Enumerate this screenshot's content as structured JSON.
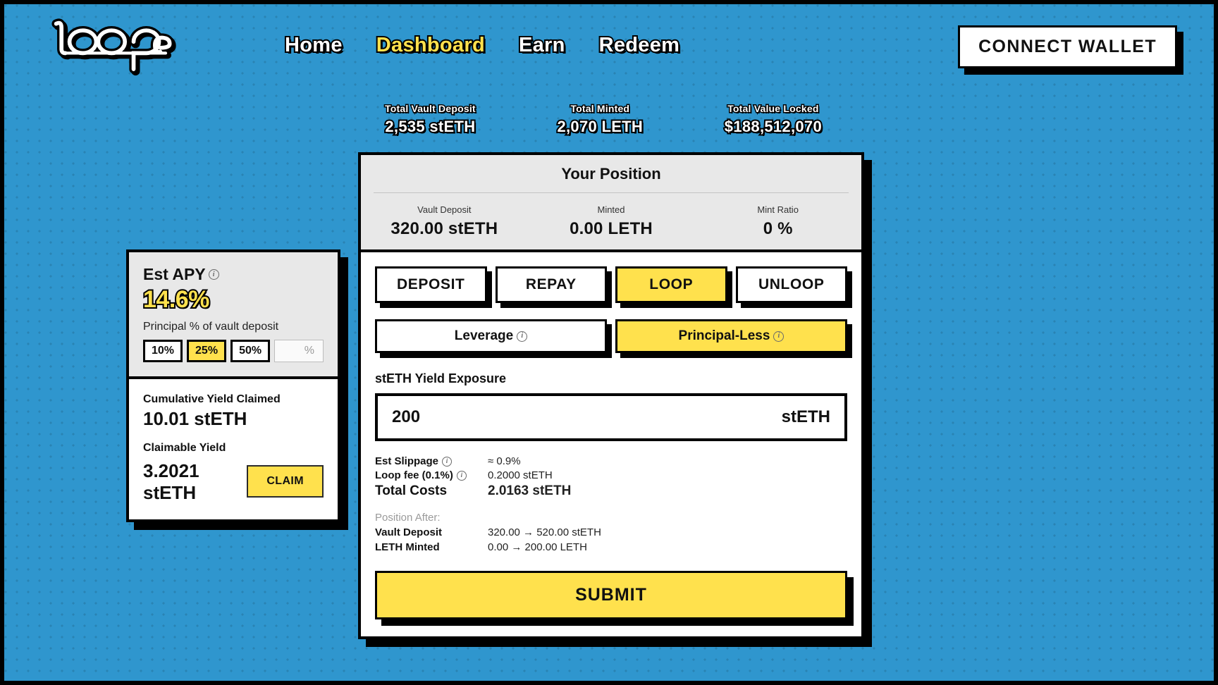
{
  "header": {
    "logo_text": "looper",
    "nav": [
      {
        "label": "Home",
        "active": false
      },
      {
        "label": "Dashboard",
        "active": true
      },
      {
        "label": "Earn",
        "active": false
      },
      {
        "label": "Redeem",
        "active": false
      }
    ],
    "connect_wallet_label": "CONNECT WALLET"
  },
  "top_stats": [
    {
      "label": "Total Vault Deposit",
      "value": "2,535 stETH"
    },
    {
      "label": "Total Minted",
      "value": "2,070 LETH"
    },
    {
      "label": "Total Value Locked",
      "value": "$188,512,070"
    }
  ],
  "position": {
    "title": "Your Position",
    "columns": [
      {
        "label": "Vault Deposit",
        "value": "320.00 stETH"
      },
      {
        "label": "Minted",
        "value": "0.00 LETH"
      },
      {
        "label": "Mint Ratio",
        "value": "0 %"
      }
    ]
  },
  "apy_card": {
    "title": "Est APY",
    "info_icon": "info-icon",
    "value": "14.6%",
    "subtitle": "Principal % of vault deposit",
    "options": [
      {
        "label": "10%",
        "selected": false
      },
      {
        "label": "25%",
        "selected": true
      },
      {
        "label": "50%",
        "selected": false
      }
    ],
    "custom_placeholder": "%"
  },
  "yield_card": {
    "cumulative_label": "Cumulative Yield Claimed",
    "cumulative_value": "10.01 stETH",
    "claimable_label": "Claimable Yield",
    "claimable_value": "3.2021 stETH",
    "claim_label": "CLAIM"
  },
  "main_panel": {
    "tabs": [
      {
        "label": "DEPOSIT",
        "active": false
      },
      {
        "label": "REPAY",
        "active": false
      },
      {
        "label": "LOOP",
        "active": true
      },
      {
        "label": "UNLOOP",
        "active": false
      }
    ],
    "modes": [
      {
        "label": "Leverage",
        "active": false
      },
      {
        "label": "Principal-Less",
        "active": true
      }
    ],
    "amount_field_label": "stETH Yield Exposure",
    "amount_value": "200",
    "amount_unit": "stETH",
    "details": [
      {
        "key": "Est Slippage",
        "has_info": true,
        "value": "≈ 0.9%"
      },
      {
        "key": "Loop fee (0.1%)",
        "has_info": true,
        "value": "0.2000 stETH"
      },
      {
        "key": "Total Costs",
        "has_info": false,
        "value": "2.0163 stETH"
      }
    ],
    "position_after_label": "Position After:",
    "position_after": [
      {
        "key": "Vault Deposit",
        "value": "320.00 → 520.00 stETH"
      },
      {
        "key": "LETH Minted",
        "value": "0.00 → 200.00 LETH"
      }
    ],
    "submit_label": "SUBMIT"
  },
  "colors": {
    "background": "#2f96ce",
    "accent_yellow": "#ffe14d",
    "outline": "#000000",
    "card_gray": "#e8e8e8",
    "card_white": "#ffffff"
  }
}
